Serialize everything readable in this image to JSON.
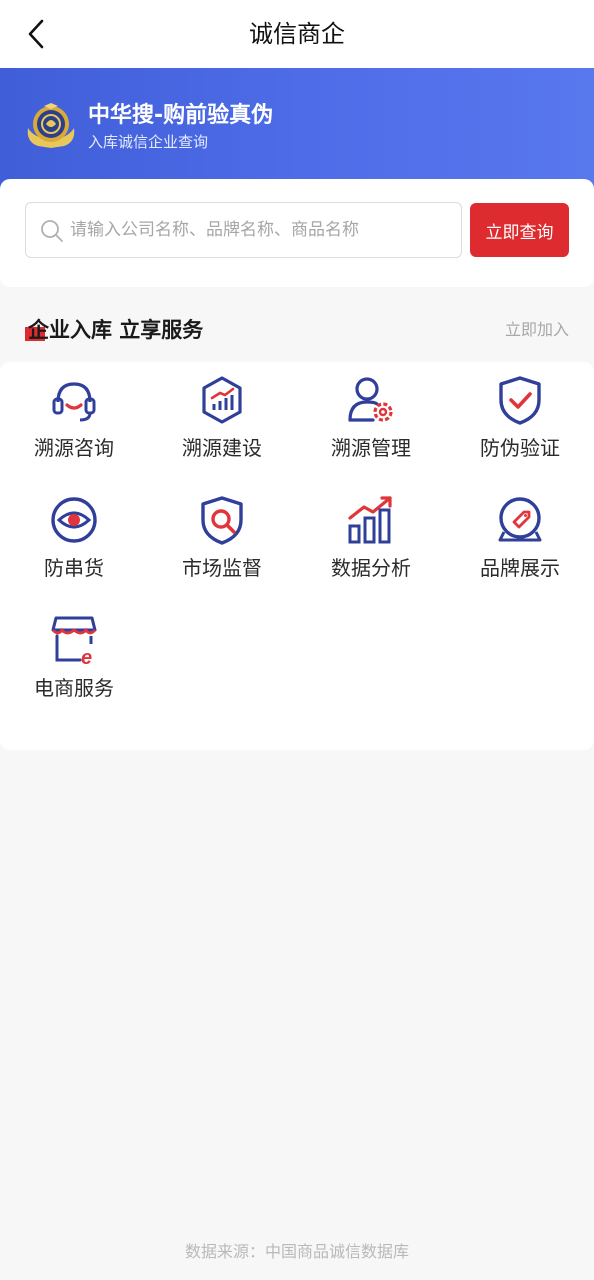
{
  "header": {
    "title": "诚信商企",
    "back_icon": "chevron-left-icon"
  },
  "banner": {
    "title": "中华搜-购前验真伪",
    "subtitle": "入库诚信企业查询",
    "badge_icon": "gold-shield-badge-icon",
    "gradient_from": "#3f5ed8",
    "gradient_to": "#5878ee"
  },
  "search": {
    "placeholder": "请输入公司名称、品牌名称、商品名称",
    "value": "",
    "button_label": "立即查询",
    "button_color": "#dd2b2f"
  },
  "section": {
    "title": "企业入库 立享服务",
    "link_label": "立即加入",
    "accent_color": "#dd2b2f"
  },
  "services": [
    {
      "label": "溯源咨询",
      "icon": "headset-icon"
    },
    {
      "label": "溯源建设",
      "icon": "hexagon-chart-icon"
    },
    {
      "label": "溯源管理",
      "icon": "user-gear-icon"
    },
    {
      "label": "防伪验证",
      "icon": "shield-check-icon"
    },
    {
      "label": "防串货",
      "icon": "eye-icon"
    },
    {
      "label": "市场监督",
      "icon": "shield-search-icon"
    },
    {
      "label": "数据分析",
      "icon": "bar-chart-trend-icon"
    },
    {
      "label": "品牌展示",
      "icon": "tag-medal-icon"
    },
    {
      "label": "电商服务",
      "icon": "shop-e-icon"
    }
  ],
  "footer": {
    "text": "数据来源：中国商品诚信数据库"
  },
  "colors": {
    "icon_blue": "#2f3f9a",
    "icon_red": "#e0353a",
    "background": "#f7f7f7"
  }
}
